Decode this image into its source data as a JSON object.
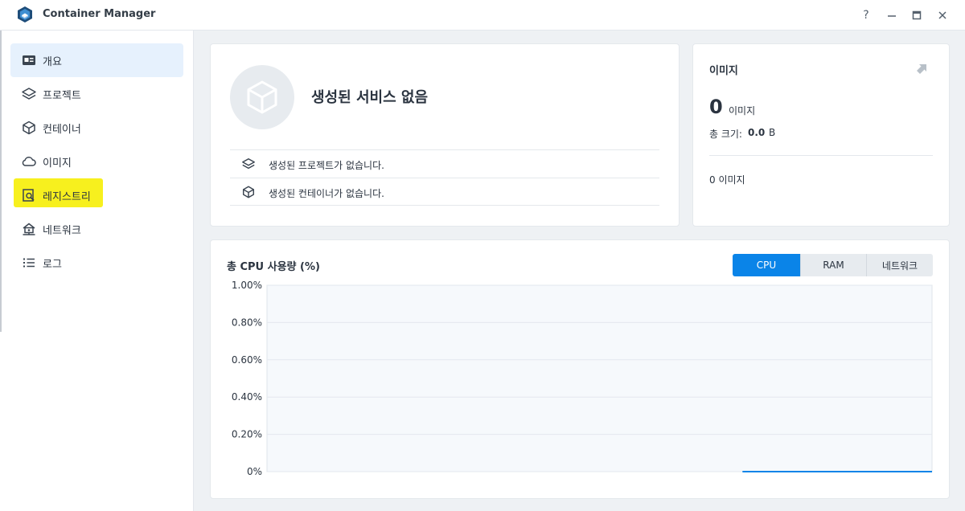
{
  "window": {
    "title": "Container Manager",
    "controls": {
      "help": "?",
      "minimize": "—",
      "maximize": "□",
      "close": "✕"
    }
  },
  "sidebar": {
    "items": [
      {
        "label": "개요",
        "icon": "overview-icon",
        "active": true
      },
      {
        "label": "프로젝트",
        "icon": "layers-icon",
        "active": false
      },
      {
        "label": "컨테이너",
        "icon": "cube-icon",
        "active": false
      },
      {
        "label": "이미지",
        "icon": "cloud-icon",
        "active": false
      },
      {
        "label": "레지스트리",
        "icon": "registry-search-icon",
        "active": false
      },
      {
        "label": "네트워크",
        "icon": "network-house-icon",
        "active": false
      },
      {
        "label": "로그",
        "icon": "list-icon",
        "active": false
      }
    ]
  },
  "services": {
    "title": "생성된 서비스 없음",
    "rows": [
      {
        "icon": "layers-icon",
        "text": "생성된 프로젝트가 없습니다."
      },
      {
        "icon": "cube-icon",
        "text": "생성된 컨테이너가 없습니다."
      }
    ]
  },
  "images": {
    "title": "이미지",
    "count": "0",
    "count_label": "이미지",
    "size_label": "총 크기:",
    "size_value": "0.0",
    "size_unit": "B",
    "summary": "0 이미지"
  },
  "cpu_panel": {
    "title": "총 CPU 사용량 (%)",
    "tabs": [
      "CPU",
      "RAM",
      "네트워크"
    ],
    "active_tab": "CPU"
  },
  "colors": {
    "accent": "#0a84e8",
    "highlight": "#f7f01e",
    "active_nav_bg": "#e6f1fd"
  },
  "chart_data": {
    "type": "line",
    "title": "총 CPU 사용량 (%)",
    "xlabel": "",
    "ylabel": "",
    "ylim": [
      0,
      1.0
    ],
    "yticks": [
      "0%",
      "0.20%",
      "0.40%",
      "0.60%",
      "0.80%",
      "1.00%"
    ],
    "ytick_values": [
      0,
      0.2,
      0.4,
      0.6,
      0.8,
      1.0
    ],
    "grid": true,
    "series": [
      {
        "x": [
          0.715,
          1.0
        ],
        "values": [
          0,
          0
        ],
        "color": "#0a84e8"
      }
    ]
  }
}
